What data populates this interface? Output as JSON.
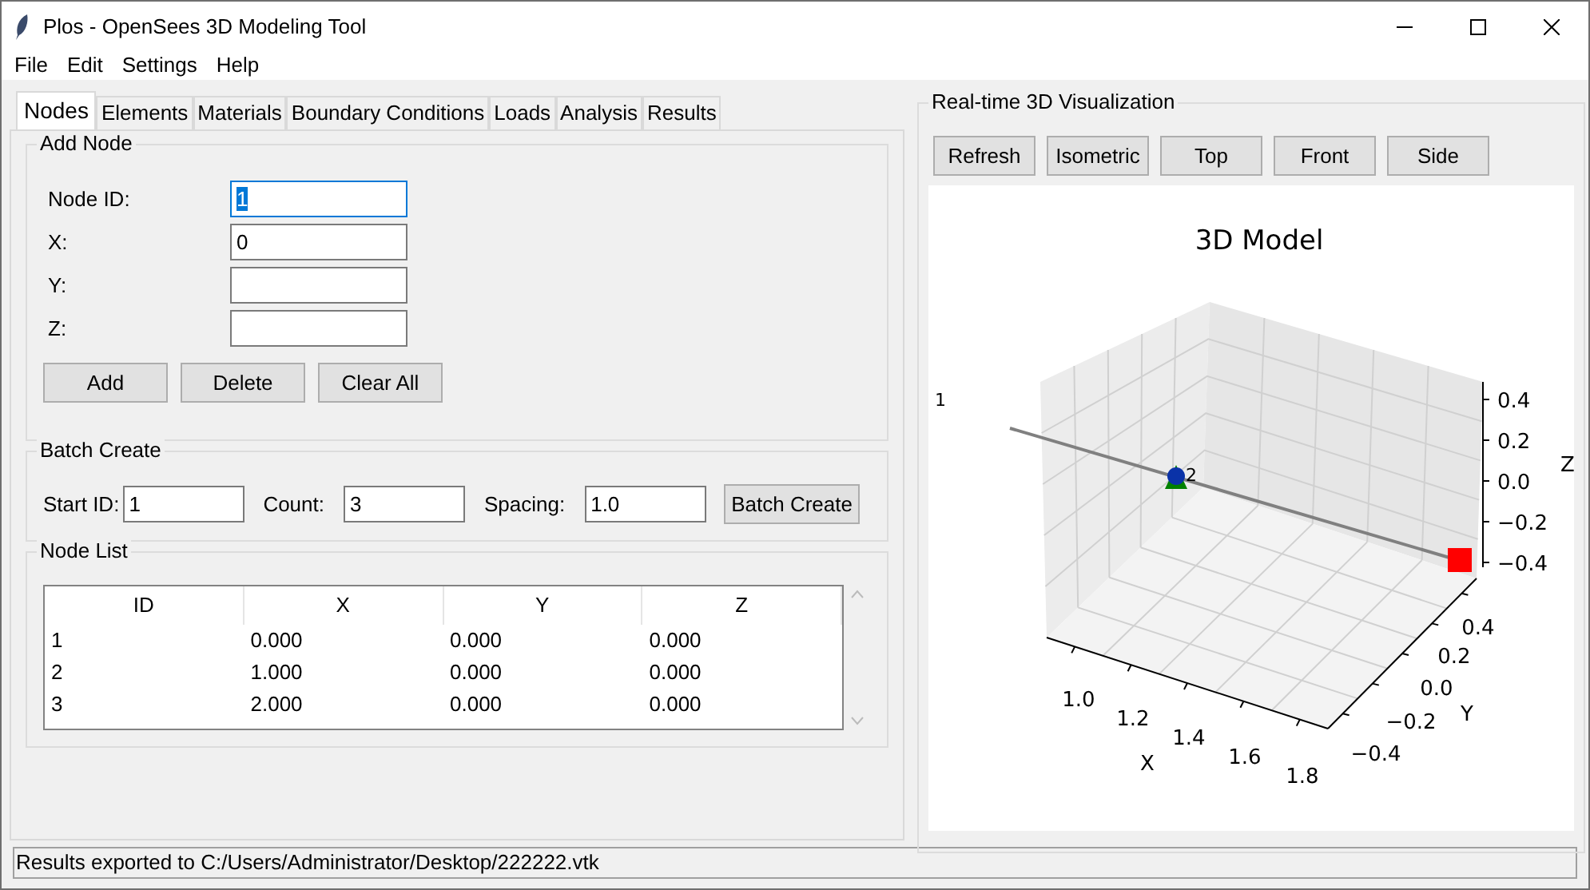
{
  "window": {
    "title": "Plos - OpenSees 3D Modeling Tool"
  },
  "menu": [
    "File",
    "Edit",
    "Settings",
    "Help"
  ],
  "tabs": [
    {
      "label": "Nodes",
      "selected": true
    },
    {
      "label": "Elements",
      "selected": false
    },
    {
      "label": "Materials",
      "selected": false
    },
    {
      "label": "Boundary Conditions",
      "selected": false
    },
    {
      "label": "Loads",
      "selected": false
    },
    {
      "label": "Analysis",
      "selected": false
    },
    {
      "label": "Results",
      "selected": false
    }
  ],
  "add_node": {
    "title": "Add Node",
    "fields": [
      {
        "label": "Node ID:",
        "value": "1",
        "focused": true
      },
      {
        "label": "X:",
        "value": "0",
        "focused": false
      },
      {
        "label": "Y:",
        "focused": false
      },
      {
        "label": "Z:",
        "focused": false
      }
    ],
    "buttons": [
      "Add",
      "Delete",
      "Clear All"
    ]
  },
  "batch_create": {
    "title": "Batch Create",
    "fields": [
      {
        "label": "Start ID:",
        "value": "1"
      },
      {
        "label": "Count:",
        "value": "3"
      },
      {
        "label": "Spacing:",
        "value": "1.0"
      }
    ],
    "button": "Batch Create"
  },
  "node_list": {
    "title": "Node List",
    "columns": [
      "ID",
      "X",
      "Y",
      "Z"
    ],
    "rows": [
      [
        "1",
        "0.000",
        "0.000",
        "0.000"
      ],
      [
        "2",
        "1.000",
        "0.000",
        "0.000"
      ],
      [
        "3",
        "2.000",
        "0.000",
        "0.000"
      ]
    ]
  },
  "visualization": {
    "title": "Real-time 3D Visualization",
    "buttons": [
      "Refresh",
      "Isometric",
      "Top",
      "Front",
      "Side"
    ],
    "plot": {
      "title": "3D Model",
      "x_label": "X",
      "y_label": "Y",
      "z_label": "Z",
      "x_ticks": [
        "1.0",
        "1.2",
        "1.4",
        "1.6",
        "1.8"
      ],
      "y_ticks": [
        "−0.4",
        "−0.2",
        "0.0",
        "0.2",
        "0.4"
      ],
      "z_ticks": [
        "0.4",
        "0.2",
        "0.0",
        "−0.2",
        "−0.4"
      ],
      "node_labels": [
        "1",
        "2"
      ]
    }
  },
  "status_bar": {
    "text": "Results exported to C:/Users/Administrator/Desktop/222222.vtk"
  }
}
